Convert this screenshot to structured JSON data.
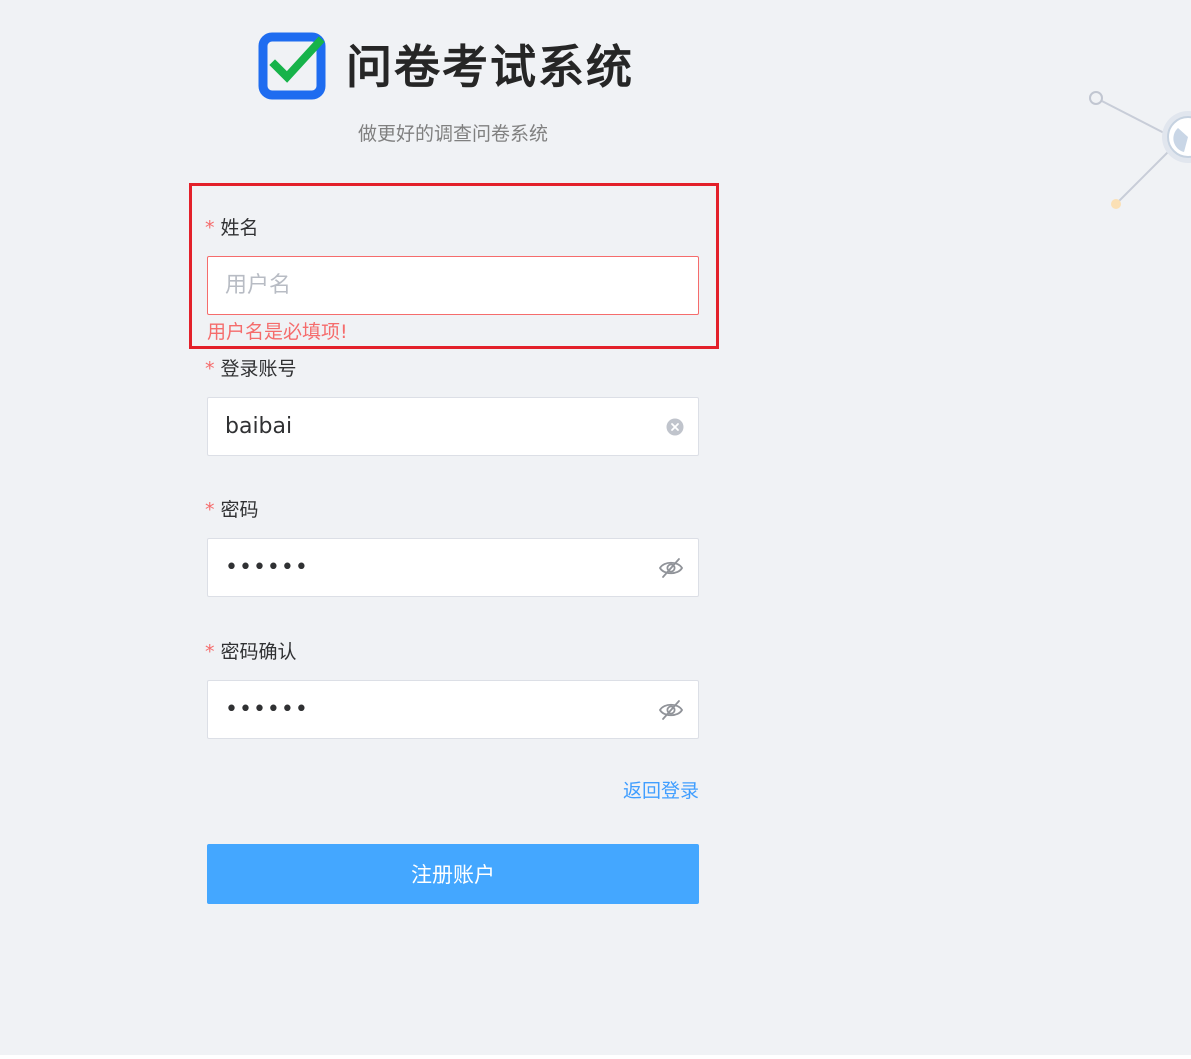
{
  "app": {
    "title": "问卷考试系统",
    "subtitle": "做更好的调查问卷系统",
    "logo_icon": "checkbox-check-icon"
  },
  "form": {
    "name": {
      "label": "姓名",
      "required_mark": "*",
      "value": "",
      "placeholder": "用户名",
      "error": "用户名是必填项!"
    },
    "account": {
      "label": "登录账号",
      "required_mark": "*",
      "value": "baibai",
      "suffix_icon": "clear-circle-icon"
    },
    "password": {
      "label": "密码",
      "required_mark": "*",
      "value": "123456",
      "suffix_icon": "eye-slash-icon"
    },
    "confirm_password": {
      "label": "密码确认",
      "required_mark": "*",
      "value": "123456",
      "suffix_icon": "eye-slash-icon"
    }
  },
  "links": {
    "back_to_login": "返回登录"
  },
  "buttons": {
    "register": "注册账户"
  },
  "colors": {
    "background": "#f0f2f5",
    "primary": "#409eff",
    "button": "#44a7ff",
    "error": "#f56c6c",
    "highlight": "#e3202a",
    "logo_blue": "#1e6cf0",
    "logo_check": "#17b34a"
  }
}
